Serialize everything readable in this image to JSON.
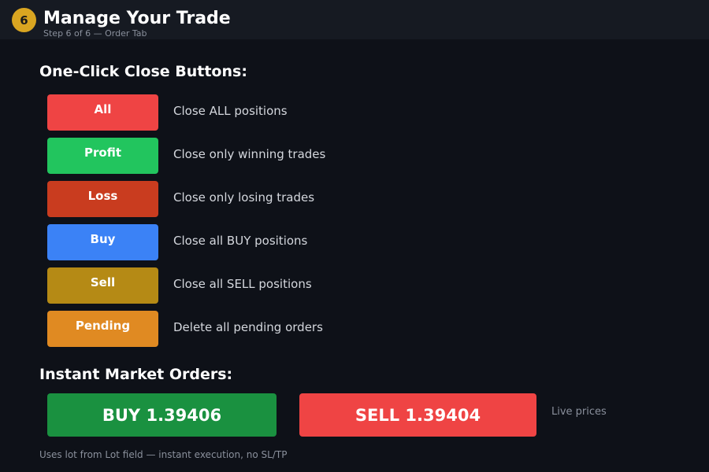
{
  "header": {
    "step_number": "6",
    "title": "Manage Your Trade",
    "subtitle": "Step 6 of 6 — Order Tab"
  },
  "close_section": {
    "heading": "One-Click Close Buttons:",
    "buttons": [
      {
        "label": "All",
        "description": "Close ALL positions",
        "color": "#ef4444"
      },
      {
        "label": "Profit",
        "description": "Close only winning trades",
        "color": "#22c55e"
      },
      {
        "label": "Loss",
        "description": "Close only losing trades",
        "color": "#c93c1f"
      },
      {
        "label": "Buy",
        "description": "Close all BUY positions",
        "color": "#3b82f6"
      },
      {
        "label": "Sell",
        "description": "Close all SELL positions",
        "color": "#b58a15"
      },
      {
        "label": "Pending",
        "description": "Delete all pending orders",
        "color": "#e08a22"
      }
    ]
  },
  "market_section": {
    "heading": "Instant Market Orders:",
    "buy_label": "BUY 1.39406",
    "buy_color": "#1a9140",
    "sell_label": "SELL 1.39404",
    "sell_color": "#ef4444",
    "live_prices_label": "Live prices",
    "footnote": "Uses lot from Lot field — instant execution, no SL/TP"
  }
}
